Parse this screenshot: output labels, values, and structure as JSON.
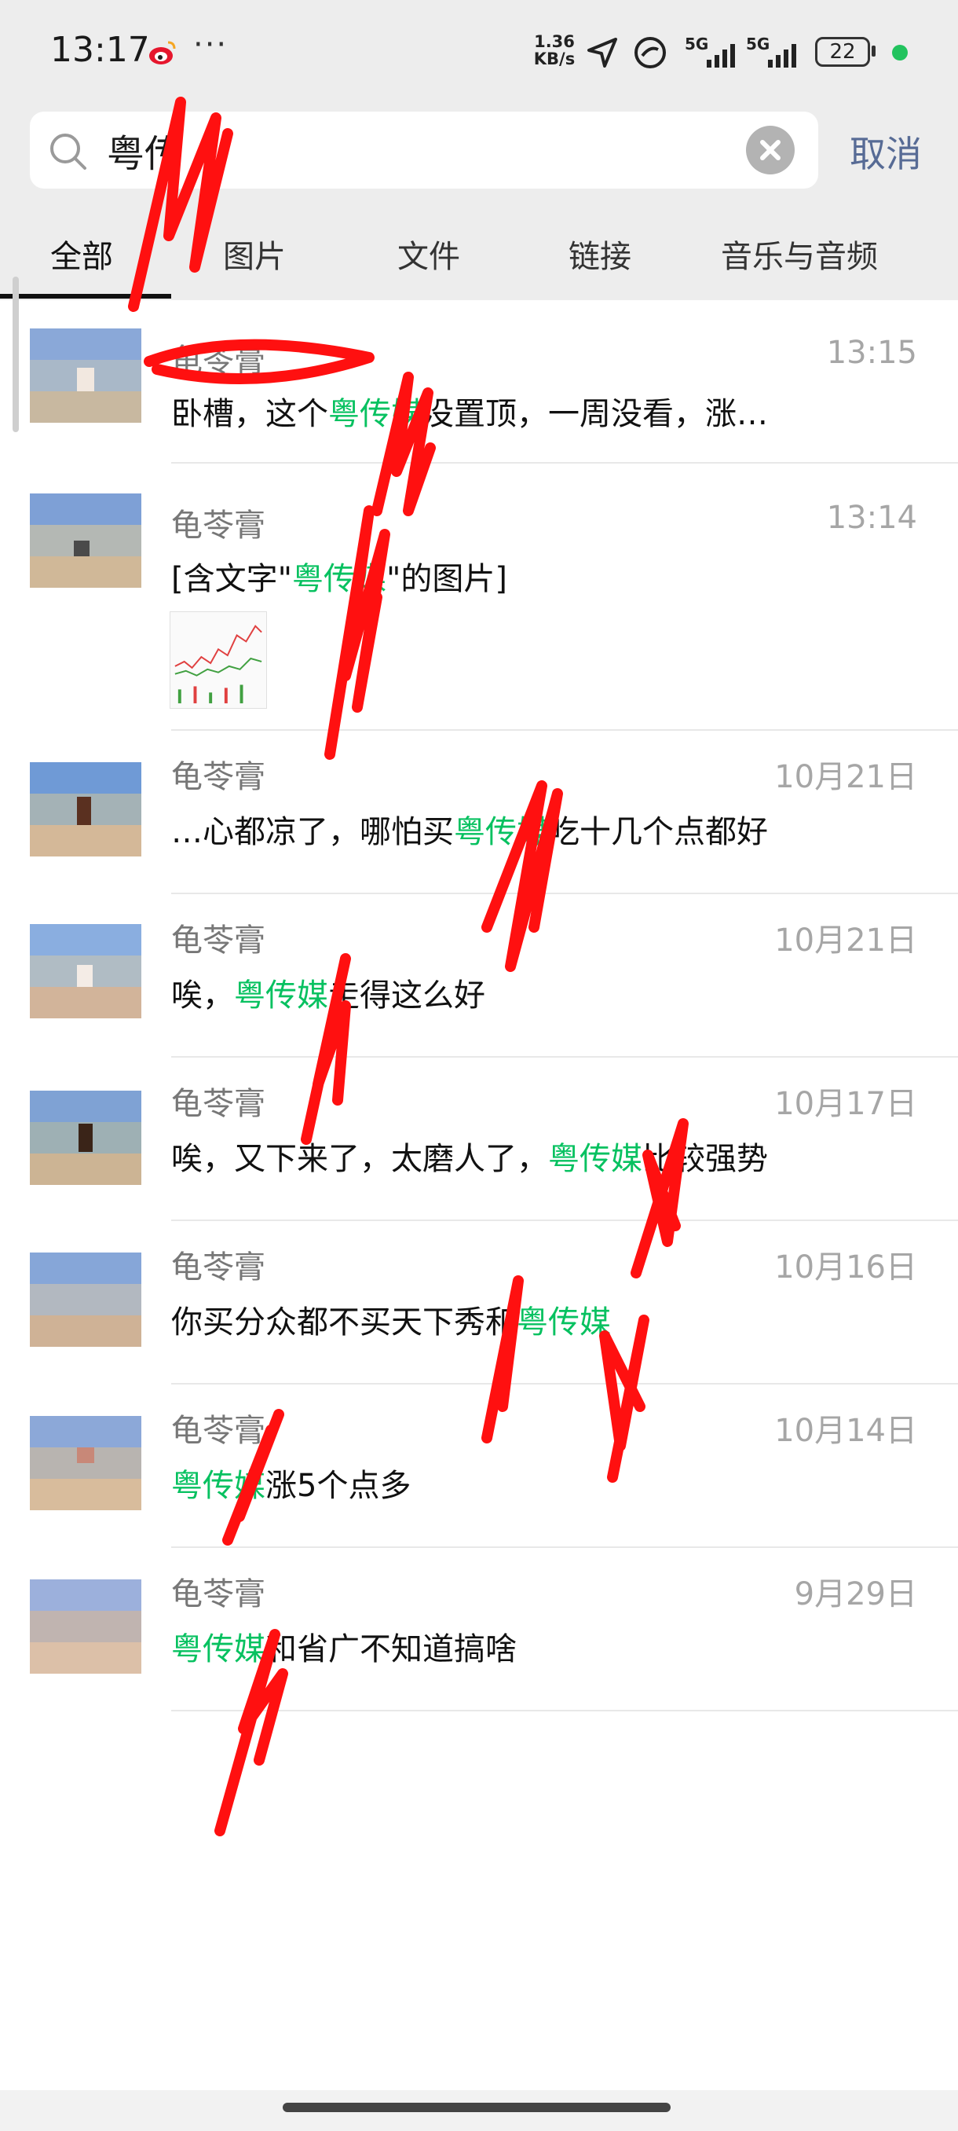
{
  "status_bar": {
    "time": "13:17",
    "more": "···",
    "net_speed_value": "1.36",
    "net_speed_unit": "KB/s",
    "signal1_label": "5G",
    "signal2_label": "5G",
    "battery": "22",
    "icons": [
      "weibo-icon",
      "location-arrow-icon",
      "link-icon",
      "signal-icon",
      "battery-icon",
      "green-dot-icon"
    ]
  },
  "search": {
    "query": "粤传",
    "cancel_label": "取消",
    "icons": [
      "search-icon",
      "clear-icon"
    ]
  },
  "tabs": [
    {
      "label": "全部",
      "active": true
    },
    {
      "label": "图片"
    },
    {
      "label": "文件"
    },
    {
      "label": "链接"
    },
    {
      "label": "音乐与音频"
    }
  ],
  "results": [
    {
      "sender": "龟苓膏",
      "time": "13:15",
      "pre": "卧槽，这个",
      "hl": "粤传媒",
      "post": "没置顶，一周没看，涨…"
    },
    {
      "sender": "龟苓膏",
      "time": "13:14",
      "pre": "[含文字\"",
      "hl": "粤传媒",
      "post": "\"的图片]",
      "has_thumbnail": true
    },
    {
      "sender": "龟苓膏",
      "time": "10月21日",
      "pre": "…心都凉了，哪怕买",
      "hl": "粤传媒",
      "post": "吃十几个点都好"
    },
    {
      "sender": "龟苓膏",
      "time": "10月21日",
      "pre": "唉，",
      "hl": "粤传媒",
      "post": "走得这么好"
    },
    {
      "sender": "龟苓膏",
      "time": "10月17日",
      "pre": "唉，又下来了，太磨人了，",
      "hl": "粤传媒",
      "post": "比较强势"
    },
    {
      "sender": "龟苓膏",
      "time": "10月16日",
      "pre": "你买分众都不买天下秀和",
      "hl": "粤传媒",
      "post": ""
    },
    {
      "sender": "龟苓膏",
      "time": "10月14日",
      "pre": "",
      "hl": "粤传媒",
      "post": "涨5个点多"
    },
    {
      "sender": "龟苓膏",
      "time": "9月29日",
      "pre": "",
      "hl": "粤传媒",
      "post": "和省广不知道搞啥"
    }
  ],
  "colors": {
    "highlight": "#07c160",
    "cancel": "#576b95",
    "scribble": "#ff1010",
    "header_bg": "#ededed"
  }
}
